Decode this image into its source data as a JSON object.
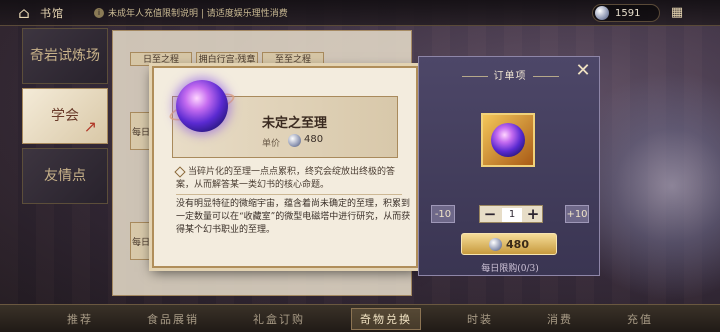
{
  "topbar": {
    "title": "书馆",
    "notice": "未成年人充值限制说明 | 请适度娱乐理性消费",
    "currency_amount": "1591",
    "home_icon": "home-icon",
    "info_icon": "info-icon",
    "grid_icon": "grid-icon"
  },
  "sidebar": {
    "items": [
      {
        "label": "奇岩试炼场"
      },
      {
        "label": "学会"
      },
      {
        "label": "友情点"
      }
    ]
  },
  "shop": {
    "tabs": [
      "日至之程",
      "拥白行宫·残章",
      "至至之程"
    ],
    "side_label_1": "每日",
    "side_label_2": "每日"
  },
  "popup": {
    "item_name": "未定之至理",
    "price_label": "单价",
    "price_value": "480",
    "description_short": "当碎片化的至理一点点累积，终究会绽放出终极的答案，从而解答某一类幻书的核心命题。",
    "description_long": "没有明显特征的微缩宇宙，蕴含着尚未确定的至理，积累到一定数量可以在“收藏室”的微型电磁塔中进行研究，从而获得某个幻书职业的至理。"
  },
  "order": {
    "title": "订单项",
    "minus10": "-10",
    "minus": "−",
    "quantity": "1",
    "plus": "+",
    "plus10": "+10",
    "total": "480",
    "limit": "每日限购(0/3)"
  },
  "bottomnav": {
    "items": [
      "推荐",
      "食品展销",
      "礼盒订购",
      "奇物兑换",
      "时装",
      "消费",
      "充值"
    ]
  }
}
